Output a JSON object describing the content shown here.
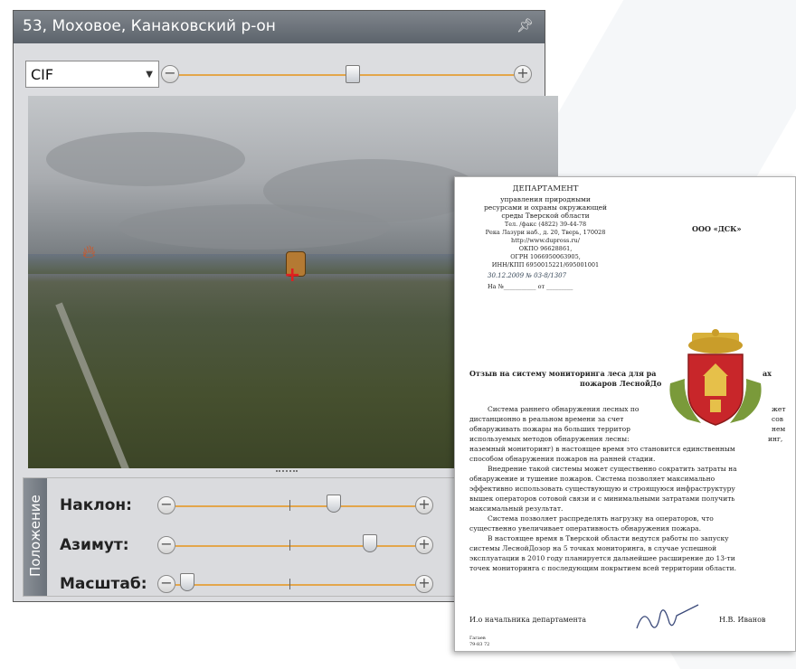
{
  "panel": {
    "title": "53, Моховое, Канаковский р-он",
    "pin_icon": "pin-icon",
    "resolution": {
      "selected": "CIF"
    },
    "zoom_slider": {
      "level": 0.52
    },
    "position_tab_label": "Положение",
    "controls": [
      {
        "label": "Наклон:",
        "value": 0.66
      },
      {
        "label": "Азимут:",
        "value": 0.81
      },
      {
        "label": "Масштаб:",
        "value": 0.05
      }
    ]
  },
  "colors": {
    "accent": "#e3a64b",
    "titlebar": "#6b727a",
    "fire": "#d9501a"
  },
  "document": {
    "header_lines": [
      "ДЕПАРТАМЕНТ",
      "управления природными",
      "ресурсами и охраны окружающей",
      "среды Тверской области",
      "Тел. /факс (4822) 39-44-78",
      "Река Лазури наб., д. 20, Тверь, 170028",
      "http://www.dupross.ru/",
      "ОКПО 96628861,",
      "ОГРН 1066950063905,",
      "ИНН/КПП 6950015221/695001001"
    ],
    "date_line": "30.12.2009   № 03-8/1307",
    "ref_line": "На №___________ от _________",
    "company": "ООО «ДСК»",
    "subject_line1": "Отзыв на систему мониторинга леса для ра",
    "subject_line1_end": "ах",
    "subject_line2": "пожаров ЛеснойДо",
    "body_lines": [
      "Система раннего обнаружения лесных по",
      "дистанционно в реальном времени за счет",
      "обнаруживать пожары на больших территор",
      "используемых методов обнаружения лесны:",
      "наземный мониторинг) в настоящее время это становится единственным",
      "способом обнаружения пожаров на ранней стадии.",
      "Внедрение такой системы может существенно сократить затраты на",
      "обнаружение и тушение пожаров. Система позволяет максимально",
      "эффективно использовать существующую и строящуюся инфраструктуру",
      "вышек операторов сотовой связи  и с минимальными затратами получить",
      "максимальный результат.",
      "Система позволяет распределять нагрузку на операторов, что",
      "существенно увеличивает оперативность обнаружения пожара.",
      "В настоящее время в Тверской области ведутся работы по запуску",
      "системы ЛеснойДозор на 5 точках мониторинга, в случае успешной",
      "эксплуатации в 2010 году планируется дальнейшее расширение до 13-ти",
      "точек мониторинга с последующим покрытием всей территории области."
    ],
    "body_right": [
      "жет",
      "сов",
      "нем",
      "инг,"
    ],
    "signer_title": "И.о начальника департамента",
    "signer_name": "Н.В. Иванов",
    "footer_lines": [
      "Гагаев",
      "79-83 72"
    ]
  }
}
